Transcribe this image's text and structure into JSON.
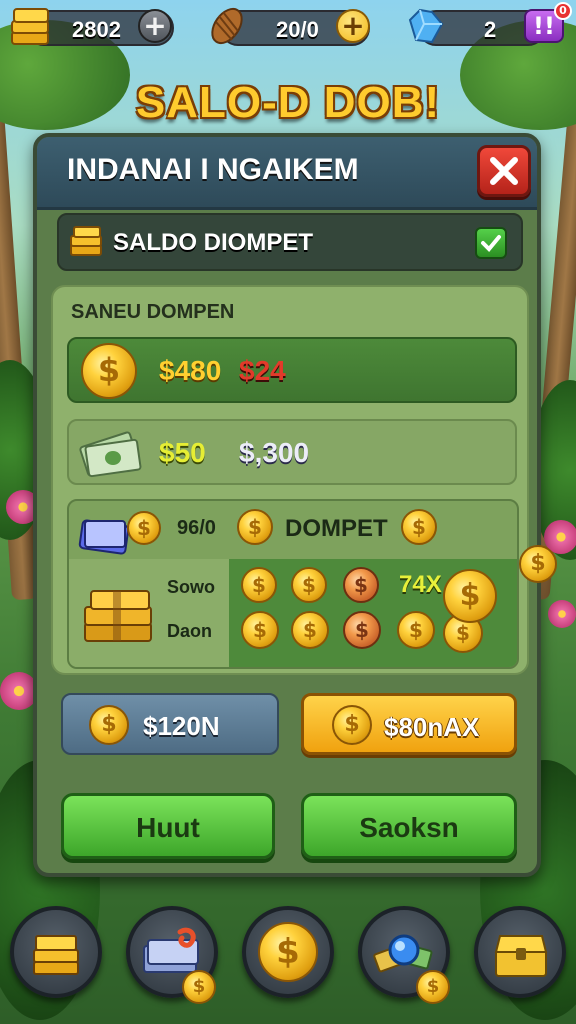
{
  "top_bar": {
    "gold_value": "2802",
    "gold_icon": "gold-bar-stack-icon",
    "wood_value": "20/0",
    "wood_icon": "wood-log-icon",
    "gem_value": "2",
    "gem_icon": "blue-gem-icon",
    "plus_glyph": "+",
    "notification_glyph": "!!",
    "notification_badge": "0"
  },
  "game_title": "SALO-D DOB!",
  "panel": {
    "title": "INDANAI I NGAIKEM",
    "close_icon": "close-x-icon",
    "wallet_label": "SALDO DIOMPET",
    "inner_label": "SANEU DOMPEN",
    "coin_row": {
      "amount_primary": "$480",
      "amount_secondary": "$24"
    },
    "cash_row": {
      "amount_primary": "$50",
      "amount_secondary": "$,300"
    },
    "dompet_row": {
      "count": "96/0",
      "label": "DOMPET",
      "side_label_1": "Sowo",
      "side_label_2": "Daon",
      "multiplier": "74X"
    }
  },
  "actions": {
    "left_pill": "$120N",
    "right_pill": "$80nAX",
    "button_left": "Huut",
    "button_right": "Saoksn"
  },
  "colors": {
    "accent_gold": "#ffcb2e",
    "primary_green": "#4db33a",
    "close_red": "#d9342a",
    "panel_green": "#5c7d4a"
  },
  "dock": [
    "gold-bars-icon",
    "cash-stack-icon",
    "dollar-coin-icon",
    "gem-treasure-icon",
    "treasure-chest-icon"
  ]
}
